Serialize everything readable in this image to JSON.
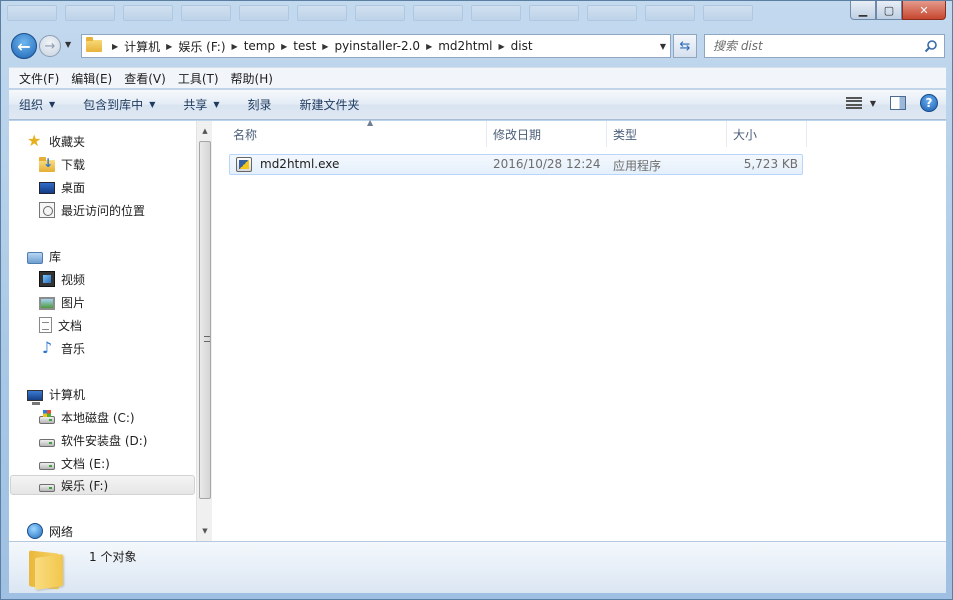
{
  "window": {
    "minimize_glyph": "▁",
    "maximize_glyph": "▢",
    "close_glyph": "✕"
  },
  "address": {
    "back_glyph": "←",
    "forward_glyph": "→",
    "breadcrumb": [
      "计算机",
      "娱乐 (F:)",
      "temp",
      "test",
      "pyinstaller-2.0",
      "md2html",
      "dist"
    ],
    "refresh_glyph": "⇆"
  },
  "search": {
    "placeholder": "搜索 dist"
  },
  "menu": [
    "文件(F)",
    "编辑(E)",
    "查看(V)",
    "工具(T)",
    "帮助(H)"
  ],
  "toolbar": {
    "organize": "组织",
    "include_in_library": "包含到库中",
    "share": "共享",
    "burn": "刻录",
    "new_folder": "新建文件夹",
    "help_glyph": "?"
  },
  "nav": {
    "favorites": "收藏夹",
    "downloads": "下载",
    "desktop": "桌面",
    "recent": "最近访问的位置",
    "libraries": "库",
    "videos": "视频",
    "pictures": "图片",
    "documents": "文档",
    "music": "音乐",
    "computer": "计算机",
    "drive_c": "本地磁盘 (C:)",
    "drive_d": "软件安装盘 (D:)",
    "drive_e": "文档 (E:)",
    "drive_f": "娱乐 (F:)",
    "network": "网络",
    "music_glyph": "♪",
    "star_glyph": "★"
  },
  "columns": {
    "name": "名称",
    "modified": "修改日期",
    "type": "类型",
    "size": "大小"
  },
  "files": [
    {
      "name": "md2html.exe",
      "modified": "2016/10/28 12:24",
      "type": "应用程序",
      "size": "5,723 KB"
    }
  ],
  "details": {
    "count": "1 个对象"
  }
}
